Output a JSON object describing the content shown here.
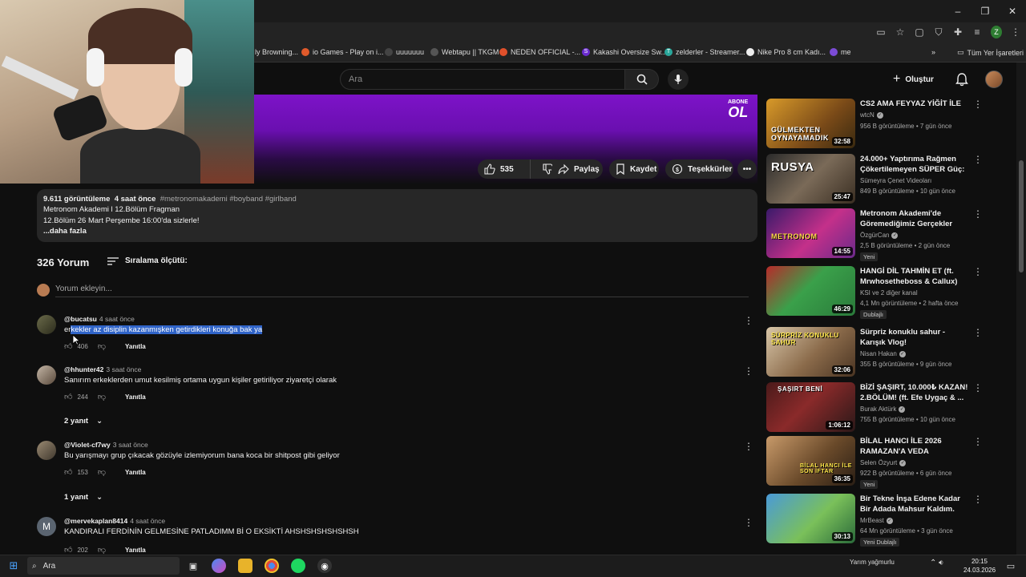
{
  "browser": {
    "bookmarks": [
      {
        "label": "ly Browning..."
      },
      {
        "label": "io Games - Play on i..."
      },
      {
        "label": "uuuuuuu"
      },
      {
        "label": "Webtapu || TKGM"
      },
      {
        "label": "NEDEN OFFICIAL -..."
      },
      {
        "label": "Kakashi Oversize Sw..."
      },
      {
        "label": "zelderler - Streamer..."
      },
      {
        "label": "Nike Pro 8 cm Kadı..."
      },
      {
        "label": "me"
      }
    ],
    "all_bookmarks_label": "Tüm Yer İşaretleri",
    "profile_initial": "Z"
  },
  "header": {
    "search_placeholder": "Ara",
    "create_label": "Oluştur"
  },
  "video": {
    "subscribe_top": "ABONE",
    "subscribe_bottom": "OL",
    "likes": "535",
    "share_label": "Paylaş",
    "save_label": "Kaydet",
    "thanks_label": "Teşekkürler"
  },
  "description": {
    "views": "9.611 görüntüleme",
    "age": "4 saat önce",
    "tags": "#metronomakademi #boyband #girlband",
    "line1": "Metronom Akademi l 12.Bölüm Fragman",
    "line2": "12.Bölüm 26 Mart Perşembe 16:00'da sizlerle!",
    "more": "...daha fazla"
  },
  "comments": {
    "count_label": "326 Yorum",
    "sort_label": "Sıralama ölçütü:",
    "add_placeholder": "Yorum ekleyin...",
    "reply_label": "Yanıtla",
    "items": [
      {
        "author": "@bucatsu",
        "time": "4 saat önce",
        "text_pre": "er",
        "text_hl": "kekler az disiplin kazanmışken getirdikleri konuğa bak ya",
        "likes": "406",
        "replies": ""
      },
      {
        "author": "@hhunter42",
        "time": "3 saat önce",
        "text_pre": "Sanırım erkeklerden umut kesilmiş ortama uygun kişiler getiriliyor ziyaretçi olarak",
        "text_hl": "",
        "likes": "244",
        "replies": "2 yanıt"
      },
      {
        "author": "@Violet-cf7wy",
        "time": "3 saat önce",
        "text_pre": "Bu yarışmayı grup çıkacak gözüyle izlemiyorum bana koca bir shitpost gibi geliyor",
        "text_hl": "",
        "likes": "153",
        "replies": "1 yanıt"
      },
      {
        "author": "@mervekaplan8414",
        "time": "4 saat önce",
        "text_pre": "KANDIRALI FERDİNİN GELMESİNE PATLADIMM Bİ O EKSİKTİ AHSHSHSHSHSHSH",
        "text_hl": "",
        "likes": "202",
        "replies": "",
        "initial": "M"
      }
    ]
  },
  "sidebar": {
    "items": [
      {
        "title": "CS2 AMA FEYYAZ YİĞİT İLE",
        "channel": "wtcN",
        "meta": "956 B görüntüleme • 7 gün önce",
        "duration": "32:58",
        "thumb_text": "GÜLMEKTEN OYNAYAMADIK",
        "badge": ""
      },
      {
        "title": "24.000+ Yaptırıma Rağmen Çökertilemeyen SÜPER Güç: ...",
        "channel": "Sümeyra Çenet Videoları",
        "meta": "849 B görüntüleme • 10 gün önce",
        "duration": "25:47",
        "thumb_text": "RUSYA",
        "badge": ""
      },
      {
        "title": "Metronom Akademi'de Göremediğimiz Gerçekler (Ban...",
        "channel": "ÖzgürCan",
        "meta": "2,5 B görüntüleme • 2 gün önce",
        "duration": "14:55",
        "thumb_text": "METRONOM",
        "badge": "Yeni"
      },
      {
        "title": "HANGİ DİL TAHMİN ET (ft. Mrwhosetheboss & Callux)",
        "channel": "KSI ve 2 diğer kanal",
        "meta": "4,1 Mn görüntüleme • 2 hafta önce",
        "duration": "46:29",
        "thumb_text": "",
        "badge": "Dublajlı"
      },
      {
        "title": "Sürpriz konuklu sahur - Karışık Vlog!",
        "channel": "Nisan Hakan",
        "meta": "355 B görüntüleme • 9 gün önce",
        "duration": "32:06",
        "thumb_text": "SÜRPRİZ KONUKLU SAHUR",
        "badge": ""
      },
      {
        "title": "BİZİ ŞAŞIRT, 10.000₺ KAZAN! 2.BÖLÜM! (ft. Efe Uygaç & ...",
        "channel": "Burak Aktürk",
        "meta": "755 B görüntüleme • 10 gün önce",
        "duration": "1:06:12",
        "thumb_text": "ŞAŞIRT BENİ",
        "badge": ""
      },
      {
        "title": "BİLAL HANCI İLE 2026 RAMAZAN'A VEDA EDİYORUZ!",
        "channel": "Selen Özyurt",
        "meta": "922 B görüntüleme • 6 gün önce",
        "duration": "36:35",
        "thumb_text": "BİLAL HANCI İLE SON İFTAR",
        "badge": "Yeni"
      },
      {
        "title": "Bir Tekne İnşa Edene Kadar Bir Adada Mahsur Kaldım.",
        "channel": "MrBeast",
        "meta": "64 Mn görüntüleme • 3 gün önce",
        "duration": "30:13",
        "thumb_text": "",
        "badge": "Yeni Dublajlı"
      }
    ]
  },
  "taskbar": {
    "search_label": "Ara",
    "weather": "Yarım yağmurlu",
    "time": "20:15",
    "date": "24.03.2026"
  },
  "colors": {
    "accent_purple": "#7d13c8",
    "highlight": "#3064c8",
    "bg": "#0f0f0f"
  }
}
